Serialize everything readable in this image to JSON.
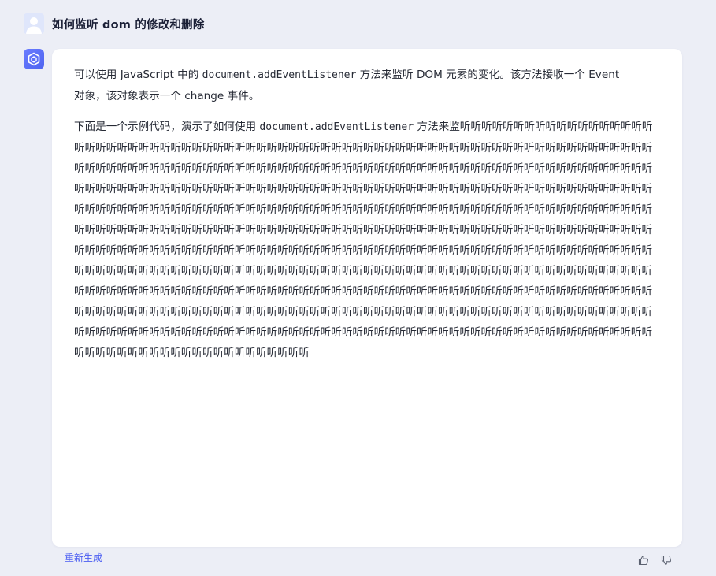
{
  "question": {
    "text": "如何监听 dom 的修改和删除"
  },
  "answer": {
    "p1_a": "可以使用 JavaScript 中的 ",
    "p1_code": "document.addEventListener",
    "p1_b": " 方法来监听 DOM 元素的变化。该方法接收一个 Event 对象，该对象表示一个 change 事件。",
    "p2_a": "下面是一个示例代码，演示了如何使用 ",
    "p2_code": "document.addEventListener",
    "p2_b": " 方法来监听听听听听听听听听听听听听听听听听听听听听听听听听听听听听听听听听听听听听听听听听听听听听听听听听听听听听听听听听听听听听听听听听听听听听听听听听听听听听听听听听听听听听听听听听听听听听听听听听听听听听听听听听听听听听听听听听听听听听听听听听听听听听听听听听听听听听听听听听听听听听听听听听听听听听听听听听听听听听听听听听听听听听听听听听听听听听听听听听听听听听听听听听听听听听听听听听听听听听听听听听听听听听听听听听听听听听听听听听听听听听听听听听听听听听听听听听听听听听听听听听听听听听听听听听听听听听听听听听听听听听听听听听听听听听听听听听听听听听听听听听听听听听听听听听听听听听听听听听听听听听听听听听听听听听听听听听听听听听听听听听听听听听听听听听听听听听听听听听听听听听听听听听听听听听听听听听听听听听听听听听听听听听听听听听听听听听听听听听听听听听听听听听听听听听听听听听听听听听听听听听听听听听听听听听听听听听听听听听听听听听听听听听听听听听听听听听听听听听听听听听听听听听听听听听听听听听听听听听听听听听听听听听听听听听听听听听听听听听听听听听听听听听听听听听听听听听听听听听听听听听听听听听听听听听听听听听听听听听听听听听听听听听听听听听听听听听听听听听听听听听听听听听听听听听听听听听听听听听听听听听听听听听听听听听听听听听听听听听听听听"
  },
  "footer": {
    "regenerate_label": "重新生成"
  },
  "colors": {
    "background": "#eceef6",
    "card": "#ffffff",
    "accent": "#4a5df2",
    "bot_avatar": "#5a6ff5"
  },
  "icons": {
    "user_avatar": "user-silhouette-icon",
    "bot_avatar": "cube-logo-icon",
    "like": "thumbs-up-icon",
    "dislike": "thumbs-down-icon"
  }
}
